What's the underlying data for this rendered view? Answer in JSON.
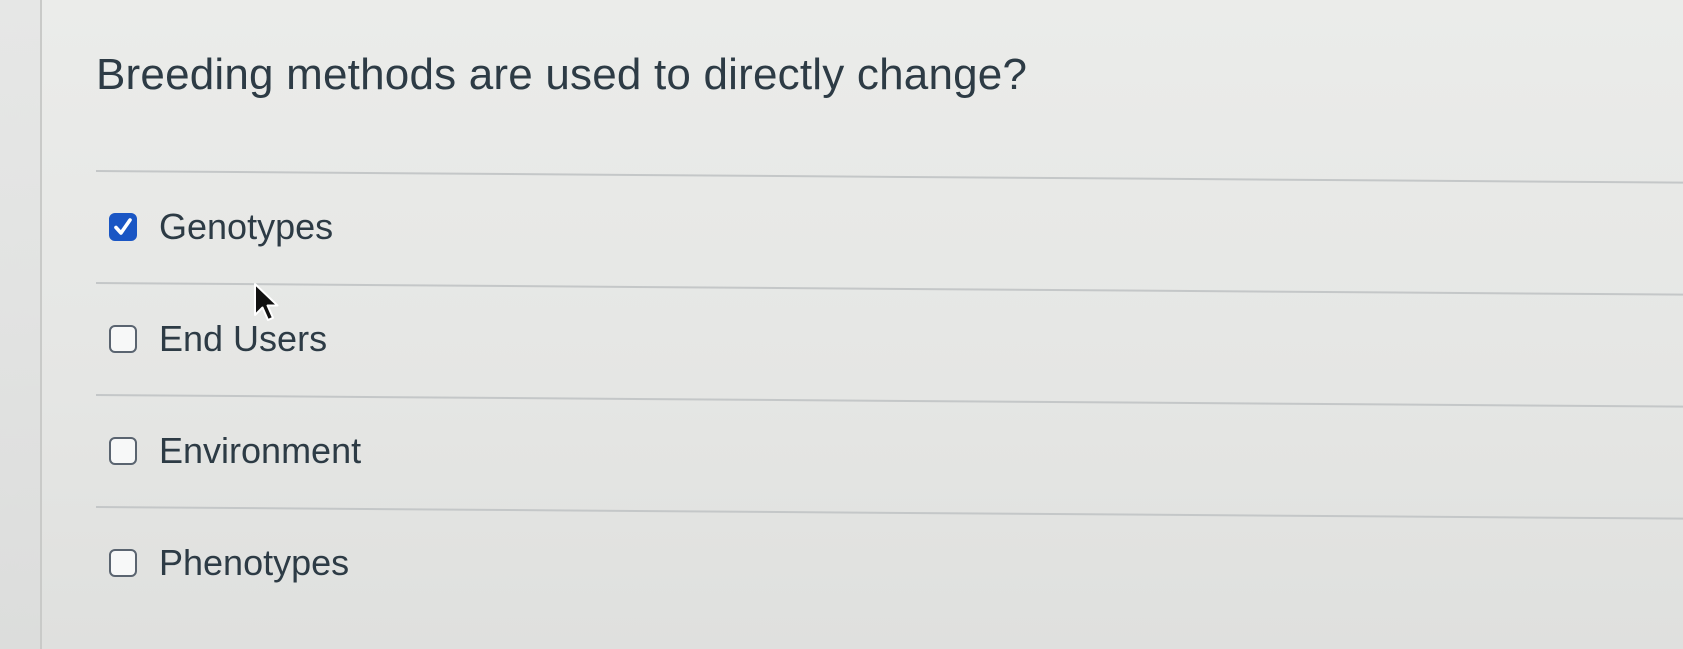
{
  "question": {
    "title": "Breeding methods are used to directly change?"
  },
  "answers": [
    {
      "label": "Genotypes",
      "checked": true
    },
    {
      "label": "End Users",
      "checked": false
    },
    {
      "label": "Environment",
      "checked": false
    },
    {
      "label": "Phenotypes",
      "checked": false
    }
  ],
  "colors": {
    "text": "#2d3b45",
    "checkbox_checked": "#1a56c4",
    "checkbox_border": "#5a6470",
    "divider": "#c4c7c8"
  },
  "icons": {
    "check": "check-icon",
    "cursor": "mouse-pointer-icon"
  }
}
